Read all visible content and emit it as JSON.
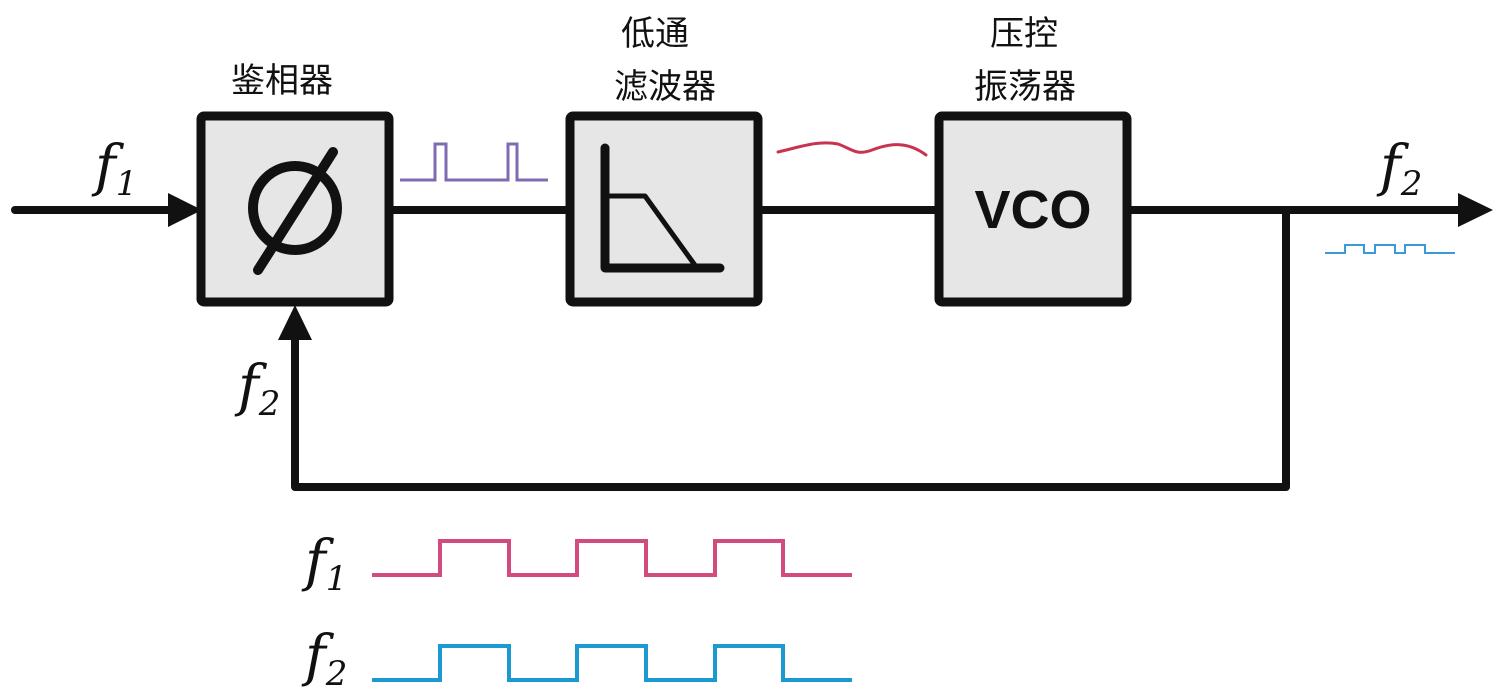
{
  "blocks": {
    "phase_detector": {
      "label": "鉴相器",
      "symbol": "∅"
    },
    "low_pass_filter": {
      "label_line1": "低通",
      "label_line2": "滤波器"
    },
    "vco": {
      "label_line1": "压控",
      "label_line2": "振荡器",
      "text": "VCO"
    }
  },
  "signals": {
    "input": {
      "name": "f",
      "sub": "1"
    },
    "output": {
      "name": "f",
      "sub": "2"
    },
    "feedback": {
      "name": "f",
      "sub": "2"
    }
  },
  "timing": {
    "f1": {
      "name": "f",
      "sub": "1"
    },
    "f2": {
      "name": "f",
      "sub": "2"
    }
  },
  "colors": {
    "line": "#111111",
    "block_fill": "#e6e6e6",
    "detector_pulse": "#7e6bb0",
    "filter_output": "#c8344f",
    "vco_output": "#3a9ad9",
    "f1_wave": "#d14b7e",
    "f2_wave": "#1b9ad2"
  }
}
